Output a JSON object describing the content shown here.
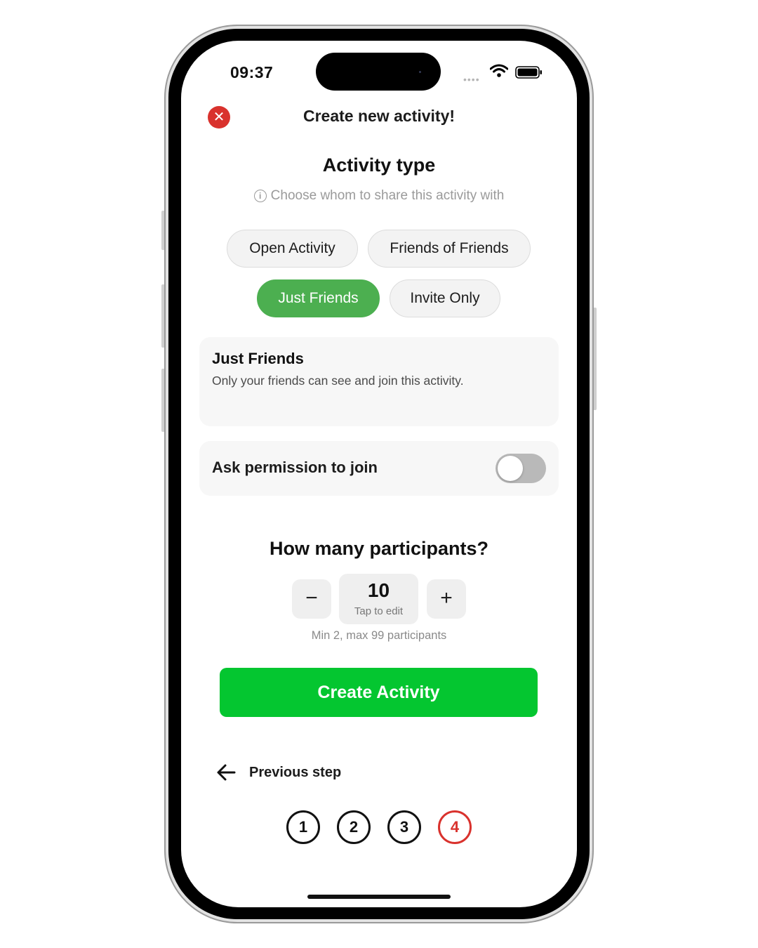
{
  "status_bar": {
    "time": "09:37",
    "signal_dots": "••••"
  },
  "header": {
    "title": "Create new activity!",
    "close_symbol": "✕"
  },
  "activity_type": {
    "title": "Activity type",
    "info_symbol": "i",
    "hint": "Choose whom to share this activity with",
    "options": [
      {
        "label": "Open Activity",
        "selected": false
      },
      {
        "label": "Friends of Friends",
        "selected": false
      },
      {
        "label": "Just Friends",
        "selected": true
      },
      {
        "label": "Invite Only",
        "selected": false
      }
    ]
  },
  "selected_description": {
    "title": "Just Friends",
    "text": "Only your friends can see and join this activity."
  },
  "permission_toggle": {
    "label": "Ask permission to join",
    "on": false
  },
  "participants": {
    "title": "How many participants?",
    "decrement_symbol": "−",
    "increment_symbol": "+",
    "value": "10",
    "hint": "Tap to edit",
    "range_note": "Min 2, max 99 participants"
  },
  "create_button": {
    "label": "Create Activity"
  },
  "navigation": {
    "previous_label": "Previous step"
  },
  "steps": [
    "1",
    "2",
    "3",
    "4"
  ],
  "current_step": 4,
  "colors": {
    "accent_green": "#04c630",
    "selected_pill": "#4caf50",
    "danger_red": "#d9322d"
  }
}
